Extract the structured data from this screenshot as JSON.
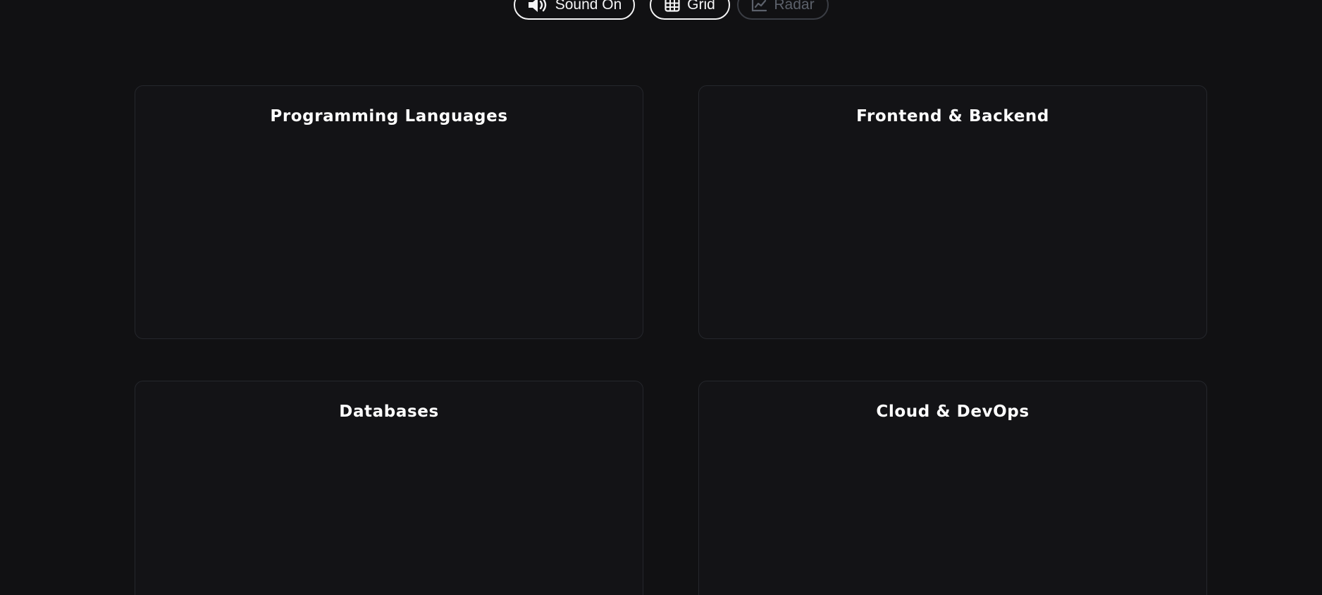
{
  "toolbar": {
    "sound_label": "Sound On",
    "sound_icon": "speaker-icon",
    "grid_label": "Grid",
    "grid_icon": "grid-icon",
    "radar_label": "Radar",
    "radar_icon": "chart-line-icon",
    "active_view": "Grid"
  },
  "cards": [
    {
      "title": "Programming Languages"
    },
    {
      "title": "Frontend & Backend"
    },
    {
      "title": "Databases"
    },
    {
      "title": "Cloud & DevOps"
    }
  ],
  "colors": {
    "background": "#111113",
    "card_background": "#131316",
    "card_border": "#25272c",
    "text": "#f4f4f5",
    "inactive": "#5c616b"
  }
}
